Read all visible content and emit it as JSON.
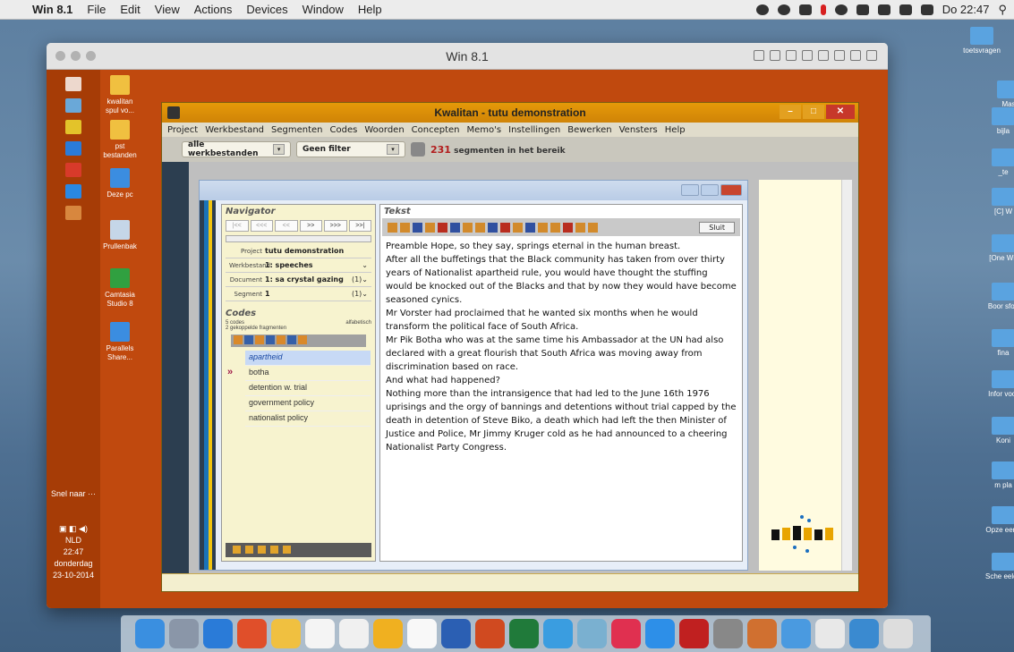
{
  "mac_menubar": {
    "app": "Win 8.1",
    "items": [
      "File",
      "Edit",
      "View",
      "Actions",
      "Devices",
      "Window",
      "Help"
    ],
    "clock": "Do 22:47"
  },
  "vm": {
    "title": "Win 8.1"
  },
  "desktop_icons": [
    "kwalitan spul vo...",
    "pst bestanden",
    "Deze pc",
    "Prullenbak",
    "Camtasia Studio 8",
    "Parallels Share..."
  ],
  "taskbar": {
    "snel": "Snel naar ···",
    "lang": "NLD",
    "time": "22:47",
    "day": "donderdag",
    "date": "23-10-2014"
  },
  "kwalitan": {
    "title": "Kwalitan - tutu demonstration",
    "menu": [
      "Project",
      "Werkbestand",
      "Segmenten",
      "Codes",
      "Woorden",
      "Concepten",
      "Memo's",
      "Instellingen",
      "Bewerken",
      "Vensters",
      "Help"
    ],
    "filter1": "alle werkbestanden",
    "filter2": "Geen filter",
    "count": "231",
    "count_label": "segmenten in het bereik"
  },
  "navigator": {
    "heading": "Navigator",
    "buttons": [
      "|<<",
      "<<<",
      "<<",
      ">>",
      ">>>",
      ">>|"
    ],
    "project_label": "Project",
    "project": "tutu demonstration",
    "werkbestand_label": "Werkbestand",
    "werkbestand": "1: speeches",
    "document_label": "Document",
    "document": "1: sa crystal gazing",
    "document_n": "(1)",
    "segment_label": "Segment",
    "segment": "1",
    "segment_n": "(1)"
  },
  "codes": {
    "heading": "Codes",
    "count": "5 codes",
    "fragments": "2 gekoppelde fragmenten",
    "sort": "alfabetisch",
    "items": [
      "apartheid",
      "botha",
      "detention w. trial",
      "government policy",
      "nationalist policy"
    ]
  },
  "tekst": {
    "heading": "Tekst",
    "close": "Sluit",
    "paragraphs": [
      "Preamble Hope, so they say, springs eternal in the human breast.",
      "After all the buffetings that the Black community has taken from over thirty years of Nationalist apartheid rule, you would have thought the stuffing would be knocked out of the Blacks and that by now they would have become seasoned cynics.",
      "Mr Vorster had proclaimed that he wanted six months when he would transform the political face of South Africa.",
      "Mr Pik Botha who was at the same time his Ambassador at the UN had also declared with a great flourish that South Africa was moving away from discrimination based on race.",
      "And what had happened?",
      "Nothing more than the intransigence that had led to the June 16th 1976 uprisings and the orgy of bannings and detentions without trial capped by the death in detention of Steve Biko, a death which had left the then Minister of Justice and Police, Mr Jimmy Kruger cold as he had announced to a cheering Nationalist Party Congress."
    ]
  },
  "right_icons": [
    "toetsvragen",
    "Mas",
    "bijla",
    "_te",
    "[C] W",
    "[One Wir",
    "Boor sfor.",
    "fina",
    "Infor voor",
    "Koni",
    "m pla",
    "Opze een..",
    "Sche eeld.."
  ]
}
